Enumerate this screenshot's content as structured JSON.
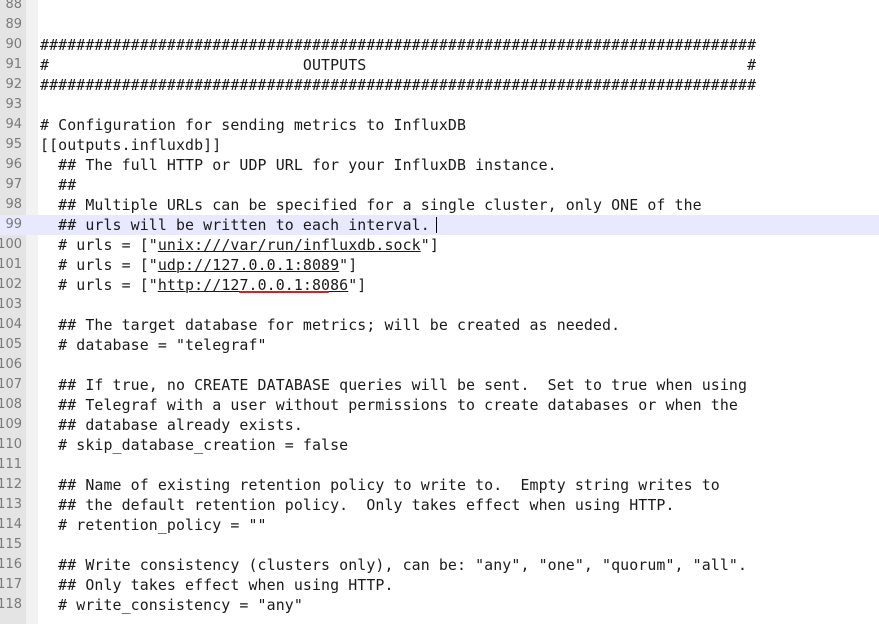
{
  "editor": {
    "lines": [
      {
        "num": "88",
        "text": ""
      },
      {
        "num": "89",
        "text": ""
      },
      {
        "num": "90",
        "text": "###############################################################################"
      },
      {
        "num": "91",
        "text": "#                            OUTPUTS                                          #"
      },
      {
        "num": "92",
        "text": "###############################################################################"
      },
      {
        "num": "93",
        "text": ""
      },
      {
        "num": "94",
        "text": "# Configuration for sending metrics to InfluxDB"
      },
      {
        "num": "95",
        "text": "[[outputs.influxdb]]"
      },
      {
        "num": "96",
        "text": "  ## The full HTTP or UDP URL for your InfluxDB instance."
      },
      {
        "num": "97",
        "text": "  ##"
      },
      {
        "num": "98",
        "text": "  ## Multiple URLs can be specified for a single cluster, only ONE of the"
      },
      {
        "num": "99",
        "text": "  ## urls will be written to each interval."
      },
      {
        "num": "100",
        "pre": "  # urls = [\"",
        "url": "unix:///var/run/influxdb.sock",
        "post": "\"]"
      },
      {
        "num": "101",
        "pre": "  # urls = [\"",
        "url": "udp://127.0.0.1:8089",
        "post": "\"]"
      },
      {
        "num": "102",
        "pre": "  # urls = [\"",
        "url": "http://127.0.0.1:8086",
        "post": "\"]"
      },
      {
        "num": "103",
        "text": ""
      },
      {
        "num": "104",
        "text": "  ## The target database for metrics; will be created as needed."
      },
      {
        "num": "105",
        "text": "  # database = \"telegraf\""
      },
      {
        "num": "106",
        "text": ""
      },
      {
        "num": "107",
        "text": "  ## If true, no CREATE DATABASE queries will be sent.  Set to true when using"
      },
      {
        "num": "108",
        "text": "  ## Telegraf with a user without permissions to create databases or when the"
      },
      {
        "num": "109",
        "text": "  ## database already exists."
      },
      {
        "num": "110",
        "text": "  # skip_database_creation = false"
      },
      {
        "num": "111",
        "text": ""
      },
      {
        "num": "112",
        "text": "  ## Name of existing retention policy to write to.  Empty string writes to"
      },
      {
        "num": "113",
        "text": "  ## the default retention policy.  Only takes effect when using HTTP."
      },
      {
        "num": "114",
        "text": "  # retention_policy = \"\""
      },
      {
        "num": "115",
        "text": ""
      },
      {
        "num": "116",
        "text": "  ## Write consistency (clusters only), can be: \"any\", \"one\", \"quorum\", \"all\"."
      },
      {
        "num": "117",
        "text": "  ## Only takes effect when using HTTP."
      },
      {
        "num": "118",
        "text": "  # write_consistency = \"any\""
      }
    ],
    "current_line": "99",
    "highlighted_line": "102"
  }
}
